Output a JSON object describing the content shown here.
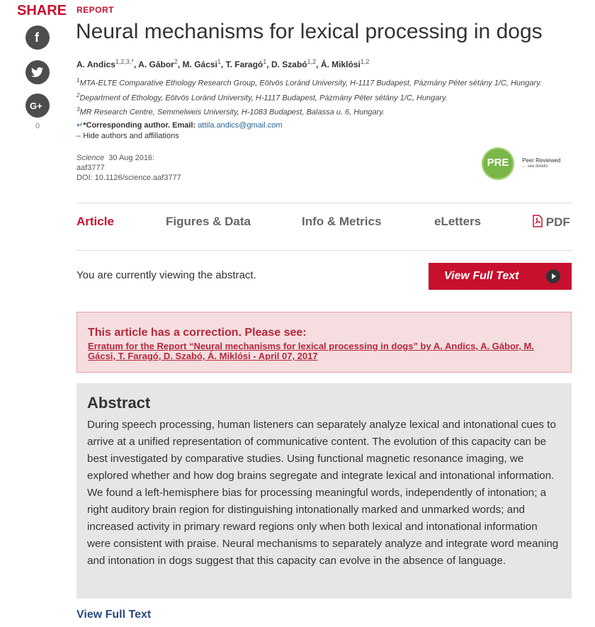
{
  "share": {
    "title": "SHARE",
    "count": "0",
    "icons": [
      "facebook-icon",
      "twitter-icon",
      "google-plus-icon"
    ]
  },
  "article": {
    "section_label": "REPORT",
    "title": "Neural mechanisms for lexical processing in dogs",
    "authors": [
      {
        "name": "A. Andics",
        "sup": "1,2,3,*"
      },
      {
        "name": "A. Gábor",
        "sup": "2"
      },
      {
        "name": "M. Gácsi",
        "sup": "1"
      },
      {
        "name": "T. Faragó",
        "sup": "1"
      },
      {
        "name": "D. Szabó",
        "sup": "1,2"
      },
      {
        "name": "Á. Miklósi",
        "sup": "1,2"
      }
    ],
    "affiliations": [
      {
        "sup": "1",
        "text": "MTA-ELTE Comparative Ethology Research Group, Eötvös Loránd University, H-1117 Budapest, Pázmány Péter sétány 1/C, Hungary."
      },
      {
        "sup": "2",
        "text": "Department of Ethology, Eötvös Loránd University, H-1117 Budapest, Pázmány Péter sétány 1/C, Hungary."
      },
      {
        "sup": "3",
        "text": "MR Research Centre, Semmelweis University, H-1083 Budapest, Balassa u. 6, Hungary."
      }
    ],
    "corresponding_label": "*Corresponding author. Email:",
    "corresponding_email": "attila.andics@gmail.com",
    "hide_label": "Hide authors and affiliations",
    "journal": "Science",
    "date": "30 Aug 2016:",
    "article_id": "aaf3777",
    "doi": "DOI: 10.1126/science.aaf3777",
    "peer_review": {
      "badge": "PRE",
      "label": "Peer Reviewed",
      "details": "← see details"
    }
  },
  "tabs": [
    {
      "label": "Article",
      "active": true
    },
    {
      "label": "Figures & Data"
    },
    {
      "label": "Info & Metrics"
    },
    {
      "label": "eLetters"
    },
    {
      "label": "PDF"
    }
  ],
  "viewing": {
    "text": "You are currently viewing the abstract.",
    "button": "View Full Text"
  },
  "correction": {
    "title": "This article has a correction. Please see:",
    "link": "Erratum for the Report “Neural mechanisms for lexical processing in dogs” by A. Andics, A. Gábor, M. Gácsi, T. Faragó, D. Szabó, Á. Miklósi - April 07, 2017"
  },
  "abstract": {
    "heading": "Abstract",
    "body": "During speech processing, human listeners can separately analyze lexical and intonational cues to arrive at a unified representation of communicative content. The evolution of this capacity can be best investigated by comparative studies. Using functional magnetic resonance imaging, we explored whether and how dog brains segregate and integrate lexical and intonational information. We found a left-hemisphere bias for processing meaningful words, independently of intonation; a right auditory brain region for distinguishing intonationally marked and unmarked words; and increased activity in primary reward regions only when both lexical and intonational information were consistent with praise. Neural mechanisms to separately analyze and integrate word meaning and intonation in dogs suggest that this capacity can evolve in the absence of language."
  },
  "bottom_link": "View Full Text",
  "colors": {
    "accent": "#c8102e",
    "link": "#2a4a7f",
    "badge": "#7ab648"
  }
}
